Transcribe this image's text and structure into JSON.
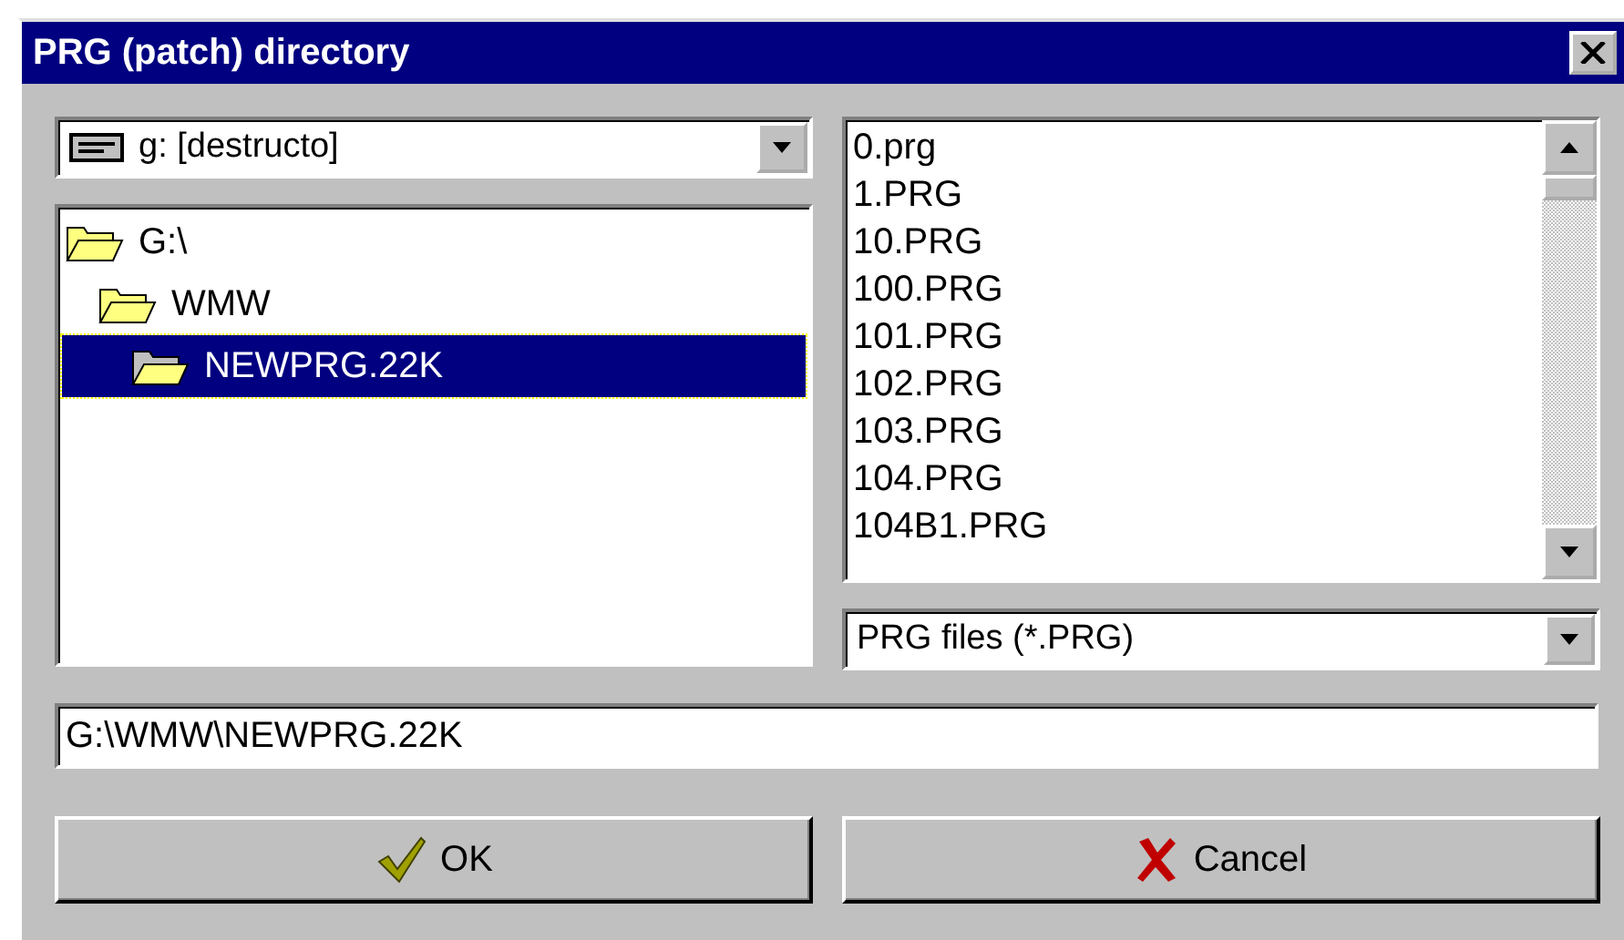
{
  "window": {
    "title": "PRG (patch) directory"
  },
  "drive": {
    "value": "g: [destructo]"
  },
  "folders": [
    {
      "label": "G:\\",
      "selected": false,
      "children": [
        {
          "label": "WMW",
          "selected": false,
          "children": [
            {
              "label": "NEWPRG.22K",
              "selected": true
            }
          ]
        }
      ]
    }
  ],
  "files": [
    "0.prg",
    "1.PRG",
    "10.PRG",
    "100.PRG",
    "101.PRG",
    "102.PRG",
    "103.PRG",
    "104.PRG",
    "104B1.PRG"
  ],
  "filter": {
    "value": "PRG files (*.PRG)"
  },
  "path": {
    "value": "G:\\WMW\\NEWPRG.22K"
  },
  "buttons": [
    {
      "kind": "ok",
      "label": "OK"
    },
    {
      "kind": "cancel",
      "label": "Cancel"
    }
  ]
}
